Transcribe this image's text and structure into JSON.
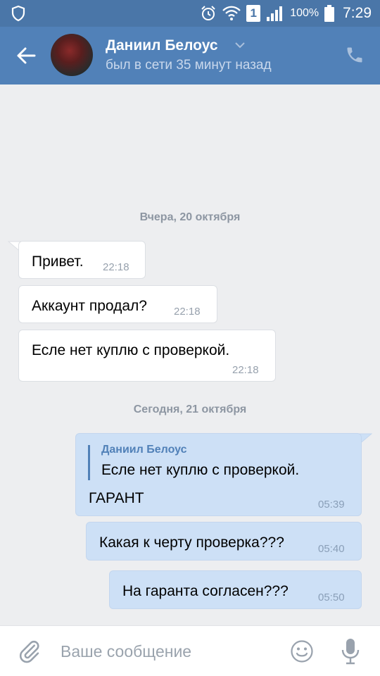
{
  "status_bar": {
    "battery_percent": "100%",
    "time": "7:29",
    "sim_number": "1",
    "icons": [
      "shield-icon",
      "alarm-icon",
      "wifi-icon",
      "sim-icon",
      "signal-icon",
      "battery-icon"
    ]
  },
  "header": {
    "contact_name": "Даниил Белоус",
    "contact_status": "был в сети 35 минут назад",
    "icons": [
      "back-arrow-icon",
      "chevron-down-icon",
      "phone-icon"
    ],
    "color": "#5181b8"
  },
  "messages": {
    "date_yesterday": "Вчера, 20 октября",
    "date_today": "Сегодня, 21 октября",
    "m1": {
      "text": "Привет.",
      "time": "22:18",
      "direction": "incoming"
    },
    "m2": {
      "text": "Аккаунт продал?",
      "time": "22:18",
      "direction": "incoming"
    },
    "m3": {
      "text": "Есле нет куплю с проверкой.",
      "time": "22:18",
      "direction": "incoming"
    },
    "m4": {
      "quote_author": "Даниил Белоус",
      "quote_text": "Есле нет куплю с проверкой.",
      "text": "ГАРАНТ",
      "time": "05:39",
      "direction": "outgoing"
    },
    "m5": {
      "text": "Какая к черту проверка???",
      "time": "05:40",
      "direction": "outgoing"
    },
    "m6": {
      "text": "На гаранта согласен???",
      "time": "05:50",
      "direction": "outgoing"
    }
  },
  "input_bar": {
    "placeholder": "Ваше сообщение",
    "value": "",
    "icons": [
      "paperclip-icon",
      "emoji-icon",
      "microphone-icon"
    ]
  }
}
